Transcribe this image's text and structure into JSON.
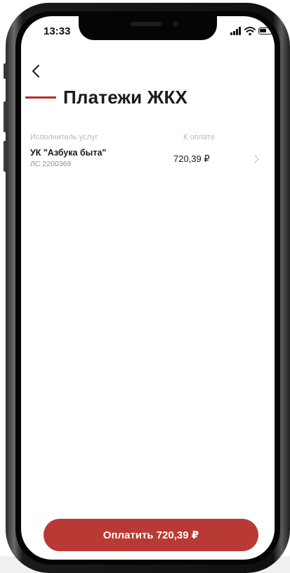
{
  "status_bar": {
    "time": "13:33",
    "icons": [
      "signal-icon",
      "wifi-icon",
      "battery-icon"
    ]
  },
  "header": {
    "back_icon": "chevron-left-icon",
    "title": "Платежи ЖКХ",
    "accent_color": "#b3302c"
  },
  "table": {
    "columns": {
      "provider": "Исполнитель услуг",
      "amount": "К оплате"
    },
    "rows": [
      {
        "provider": "УК \"Азбука быта\"",
        "account": "ЛС 2200369",
        "amount": "720,39 ₽",
        "icon": "chevron-right-icon"
      }
    ]
  },
  "footer": {
    "pay_label": "Оплатить 720,39 ₽",
    "button_color": "#b93a34"
  }
}
